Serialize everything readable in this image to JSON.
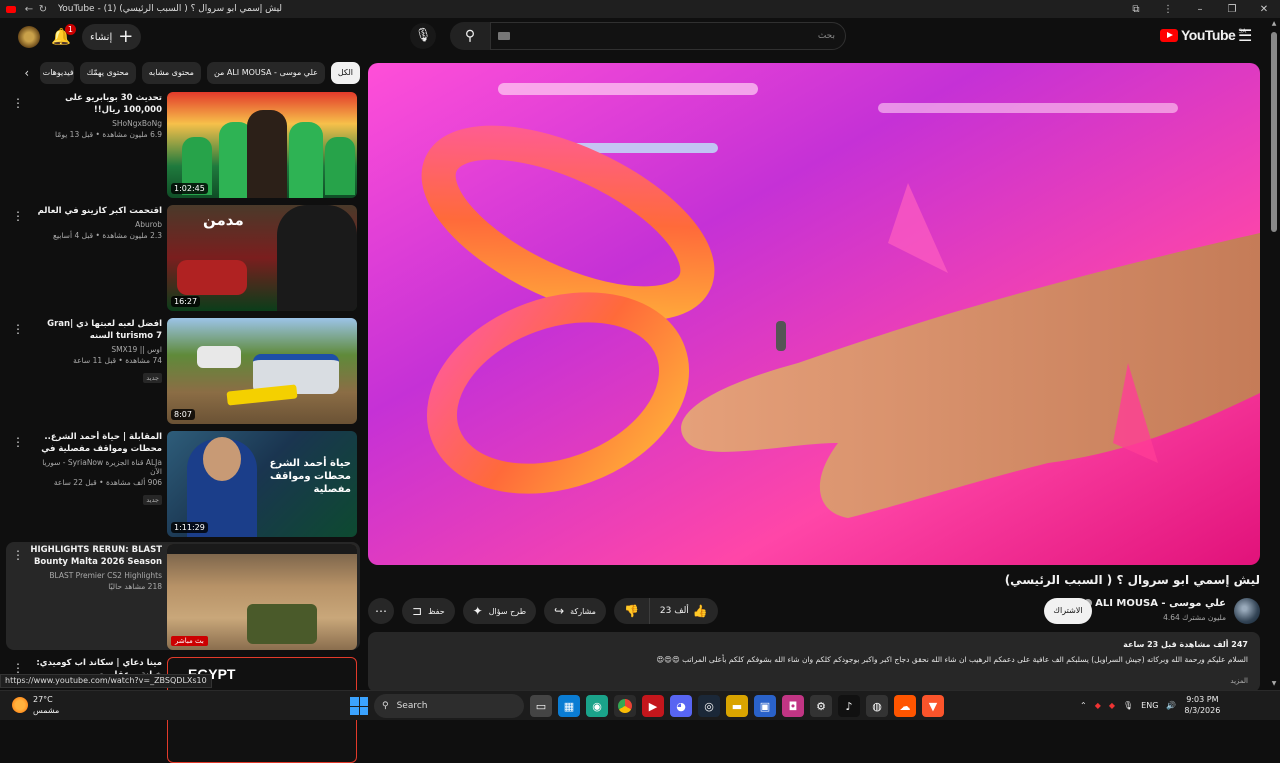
{
  "window": {
    "title": "YouTube - ليش إسمي ابو سروال ؟ ( السبب الرئيسي) (1)"
  },
  "masthead": {
    "notifications_count": "1",
    "create_label": "إنشاء",
    "search_placeholder": "بحث",
    "logo_text": "YouTube",
    "logo_region": "SA"
  },
  "chips": [
    {
      "label": "الكل",
      "active": true
    },
    {
      "label": "من ALI MOUSA - علي موسى"
    },
    {
      "label": "محتوى مشابه"
    },
    {
      "label": "محتوى يهمّك"
    },
    {
      "label": "فيديوهات"
    }
  ],
  "recommendations": [
    {
      "title": "تحديث 30 بوبابريو على 100,000 ريال!!",
      "channel": "SHoNgxBoNg",
      "stats": "6.9 مليون مشاهدة • قبل 13 يومًا",
      "duration": "1:02:45"
    },
    {
      "title": "اقتحمت اكبر كازينو في العالم",
      "channel": "Aburob",
      "stats": "2.3 مليون مشاهدة • قبل 4 أسابيع",
      "duration": "16:27",
      "thumb_text": "مدمن"
    },
    {
      "title": "افضل لعبه لعبتها ذي |Gran turismo 7 السنه",
      "channel": "اوس || SMX19",
      "stats": "74 مشاهدة • قبل 11 ساعة",
      "badge": "جديد",
      "duration": "8:07"
    },
    {
      "title": "المقابلة | حياة أحمد الشرع.. محطات ومواقف مفصلية في مسيرة الرئيس السوري",
      "channel": "ALJa قناة الجزيرة SyriaNow - سوريا الآن",
      "stats": "906 ألف مشاهدة • قبل 22 ساعة",
      "badge": "جديد",
      "duration": "1:11:29",
      "thumb_text": "حياة أحمد الشرع محطات ومواقف مفصلية"
    },
    {
      "title": "HIGHLIGHTS RERUN: BLAST Bounty Malta 2026 Season 2",
      "channel": "BLAST Premier CS2 Highlights",
      "stats": "218 مشاهد حاليًا",
      "live": "بث مباشر"
    },
    {
      "title": "مينا دعاي | سكاند اب كوميدي: خيانة و عقاريت",
      "channel": "",
      "stats": "",
      "thumb_text": "EGYPT"
    }
  ],
  "video": {
    "title": "ليش إسمي ابو سروال ؟ ( السبب الرئيسي)",
    "channel_name": "ALI MOUSA - علي موسى",
    "subscribers": "4.64 مليون مشترك",
    "subscribe_label": "الاشتراك",
    "likes": "23 ألف",
    "share_label": "مشاركة",
    "ask_label": "طرح سؤال",
    "save_label": "حفظ",
    "description_stats": "247 ألف مشاهدة  قبل 23 ساعة",
    "description_text": "السلام عليكم ورحمة الله وبركاته (جيش السراويل) يسلبكم الف عافية على دعمكم الرهيب ان شاء الله نحقق دجاج اكبر واكبر بوجودكم كلكم وان شاء الله بشوفكم كلكم بأعلى المراتب 😍😍😍",
    "description_more": "المزيد"
  },
  "status_url": "https://www.youtube.com/watch?v=_ZBSQDLXs10",
  "taskbar": {
    "temperature": "27°C",
    "weather_label": "مشمس",
    "search_label": "Search",
    "lang": "ENG",
    "time": "9:03 PM",
    "date": "8/3/2026"
  },
  "colors": {
    "background": "#0f0f0f",
    "brand_red": "#ff0000",
    "chip_bg": "#272727"
  }
}
